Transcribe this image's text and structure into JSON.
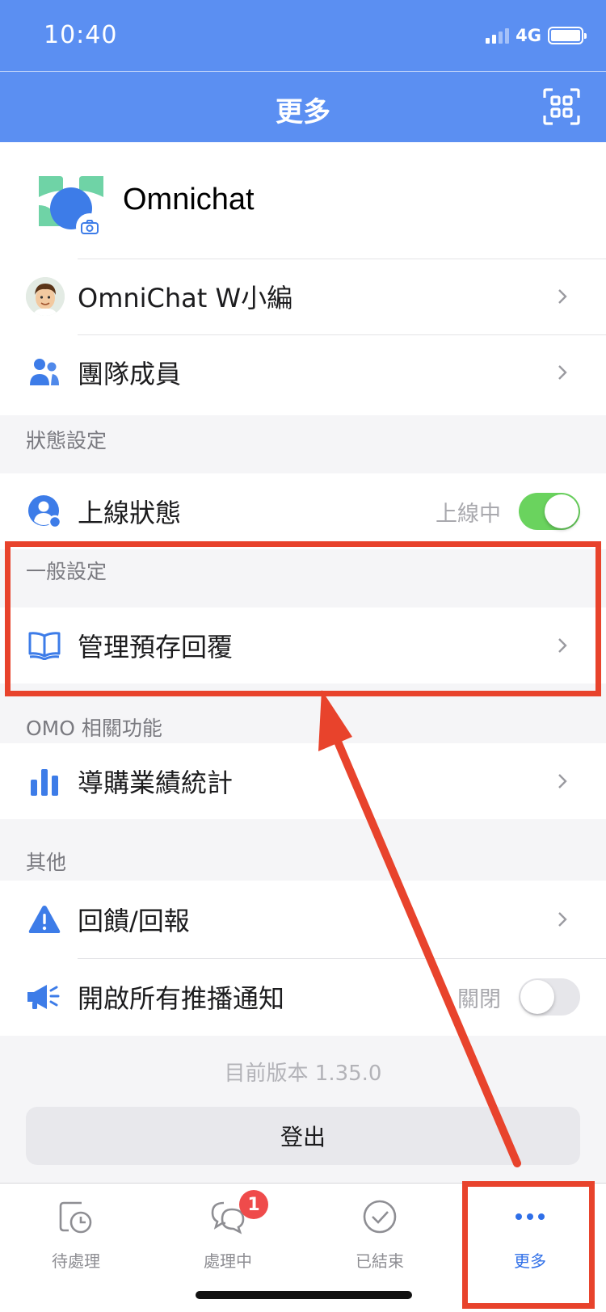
{
  "status_bar": {
    "time": "10:40",
    "network": "4G"
  },
  "nav": {
    "title": "更多"
  },
  "profile": {
    "org_name": "Omnichat"
  },
  "account_rows": [
    {
      "label": "OmniChat W小編"
    },
    {
      "label": "團隊成員"
    }
  ],
  "status_section": {
    "header": "狀態設定",
    "online_label": "上線狀態",
    "online_status": "上線中"
  },
  "general_section": {
    "header": "一般設定",
    "manage_replies_label": "管理預存回覆"
  },
  "omo_section": {
    "header": "OMO 相關功能",
    "sales_stats_label": "導購業績統計"
  },
  "other_section": {
    "header": "其他",
    "feedback_label": "回饋/回報",
    "push_label": "開啟所有推播通知",
    "push_status": "關閉"
  },
  "version_text": "目前版本  1.35.0",
  "logout_label": "登出",
  "tabs": [
    {
      "label": "待處理"
    },
    {
      "label": "處理中",
      "badge": "1"
    },
    {
      "label": "已結束"
    },
    {
      "label": "更多"
    }
  ],
  "colors": {
    "brand_blue": "#5b8ff2",
    "icon_blue": "#3d7ce8",
    "toggle_on": "#6ad35e",
    "badge_red": "#ef4b4b",
    "annotation_red": "#e8432c"
  }
}
